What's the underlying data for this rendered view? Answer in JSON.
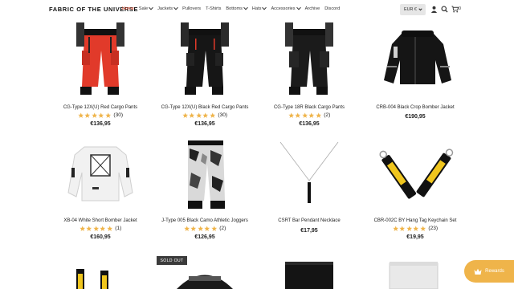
{
  "header": {
    "logo": "FABRIC OF THE UNIVERSE",
    "nav": [
      {
        "label": "Home",
        "active": true,
        "dropdown": false
      },
      {
        "label": "Sale",
        "active": false,
        "dropdown": true
      },
      {
        "label": "Jackets",
        "active": false,
        "dropdown": true
      },
      {
        "label": "Pullovers",
        "active": false,
        "dropdown": false
      },
      {
        "label": "T-Shirts",
        "active": false,
        "dropdown": false
      },
      {
        "label": "Bottoms",
        "active": false,
        "dropdown": true
      },
      {
        "label": "Hats",
        "active": false,
        "dropdown": true
      },
      {
        "label": "Accessories",
        "active": false,
        "dropdown": true
      },
      {
        "label": "Archive",
        "active": false,
        "dropdown": false
      },
      {
        "label": "Discord",
        "active": false,
        "dropdown": false
      }
    ],
    "currency": "EUR €",
    "cart_count": "0",
    "icons": [
      "user-icon",
      "search-icon",
      "cart-icon"
    ]
  },
  "products": [
    {
      "title": "CG-Type 12X(U) Red Cargo Pants",
      "rating": 5,
      "reviews": "(30)",
      "price": "€136,95"
    },
    {
      "title": "CG-Type 12X(U) Black Red Cargo Pants",
      "rating": 5,
      "reviews": "(30)",
      "price": "€136,95"
    },
    {
      "title": "CG-Type 18R Black Cargo Pants",
      "rating": 5,
      "reviews": "(2)",
      "price": "€136,95"
    },
    {
      "title": "CRB-004 Black Crop Bomber Jacket",
      "rating": 0,
      "reviews": "",
      "price": "€190,95"
    },
    {
      "title": "XB-04 White Short Bomber Jacket",
      "rating": 5,
      "reviews": "(1)",
      "price": "€160,95"
    },
    {
      "title": "J-Type 005 Black Camo Athletic Joggers",
      "rating": 5,
      "reviews": "(2)",
      "price": "€126,95"
    },
    {
      "title": "CSRT Bar Pendant Necklace",
      "rating": 0,
      "reviews": "",
      "price": "€17,95"
    },
    {
      "title": "CBR-002C BY Hang Tag Keychain Set",
      "rating": 5,
      "reviews": "(23)",
      "price": "€19,95"
    }
  ],
  "sold_out_label": "SOLD OUT",
  "rewards_label": "Rewards",
  "colors": {
    "accent": "#e2472b",
    "star": "#efb44a",
    "rewards": "#efb44a"
  }
}
